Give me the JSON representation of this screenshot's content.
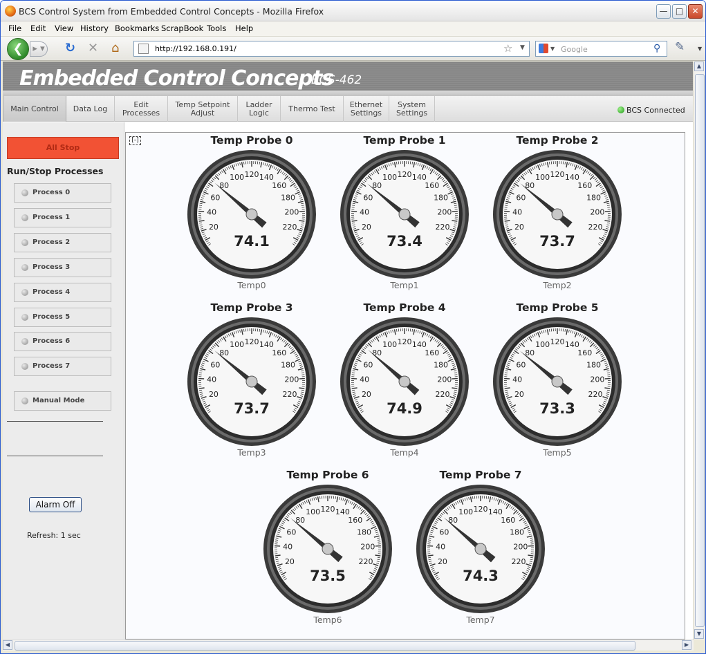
{
  "window": {
    "title": "BCS Control System from Embedded Control Concepts - Mozilla Firefox"
  },
  "menubar": [
    "File",
    "Edit",
    "View",
    "History",
    "Bookmarks",
    "ScrapBook",
    "Tools",
    "Help"
  ],
  "navbar": {
    "url": "http://192.168.0.191/",
    "search_placeholder": "Google"
  },
  "banner": {
    "brand": "Embedded Control Concepts",
    "model": "BCS-462"
  },
  "tabs": [
    {
      "label": "Main Control",
      "active": true
    },
    {
      "label": "Data Log"
    },
    {
      "label": "Edit\nProcesses"
    },
    {
      "label": "Temp Setpoint\nAdjust"
    },
    {
      "label": "Ladder\nLogic"
    },
    {
      "label": "Thermo Test"
    },
    {
      "label": "Ethernet\nSettings"
    },
    {
      "label": "System\nSettings"
    }
  ],
  "status": {
    "connection": "BCS Connected",
    "connection_color": "#1f9a17"
  },
  "sidebar": {
    "all_stop": "All Stop",
    "all_stop_color": "#f25234",
    "heading": "Run/Stop Processes",
    "processes": [
      "Process 0",
      "Process 1",
      "Process 2",
      "Process 3",
      "Process 4",
      "Process 5",
      "Process 6",
      "Process 7"
    ],
    "manual_mode": "Manual Mode",
    "alarm_button": "Alarm Off",
    "refresh": "Refresh: 1 sec"
  },
  "collapse_label": "[-]",
  "gauge_scale": {
    "min": 0,
    "max": 240,
    "labels": [
      20,
      40,
      60,
      80,
      100,
      120,
      140,
      160,
      180,
      200,
      220
    ]
  },
  "probes": [
    {
      "title": "Temp Probe 0",
      "name": "Temp0",
      "value": "74.1"
    },
    {
      "title": "Temp Probe 1",
      "name": "Temp1",
      "value": "73.4"
    },
    {
      "title": "Temp Probe 2",
      "name": "Temp2",
      "value": "73.7"
    },
    {
      "title": "Temp Probe 3",
      "name": "Temp3",
      "value": "73.7"
    },
    {
      "title": "Temp Probe 4",
      "name": "Temp4",
      "value": "74.9"
    },
    {
      "title": "Temp Probe 5",
      "name": "Temp5",
      "value": "73.3"
    },
    {
      "title": "Temp Probe 6",
      "name": "Temp6",
      "value": "73.5"
    },
    {
      "title": "Temp Probe 7",
      "name": "Temp7",
      "value": "74.3"
    }
  ]
}
